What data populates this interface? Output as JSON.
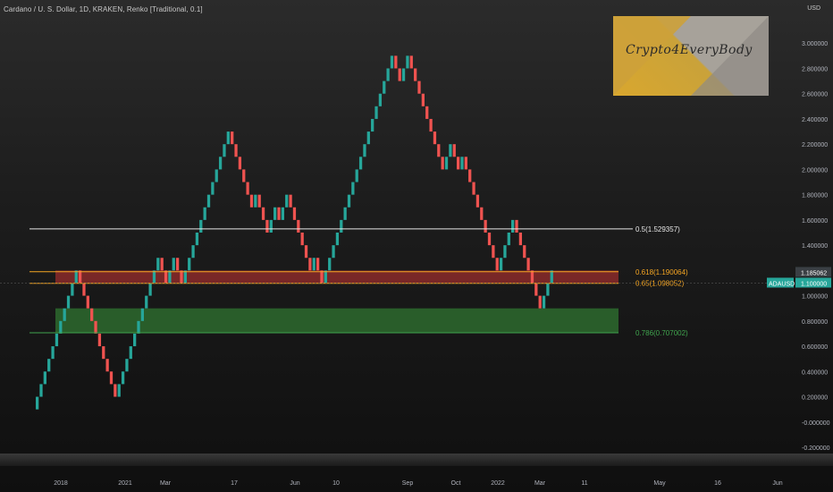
{
  "header": {
    "title": "Cardano / U. S. Dollar, 1D, KRAKEN, Renko [Traditional, 0.1]",
    "currency": "USD"
  },
  "logo": {
    "text": "Crypto4EveryBody"
  },
  "ticker": {
    "symbol": "ADAUSD",
    "last_price": "1.185062",
    "pending_price": "1.100000"
  },
  "colors": {
    "up": "#26a69a",
    "down": "#ef5350",
    "fib_white": "#e6e6e6",
    "fib_orange": "#f5a623",
    "fib_green": "#3fa34d",
    "resistance_zone": "#8b2a2a",
    "support_zone": "#2d6a2e",
    "ticker_badge": "#26a69a"
  },
  "chart_data": {
    "type": "renko",
    "brick_size": 0.1,
    "y_range": [
      -0.2,
      3.2
    ],
    "y_ticks": [
      "3.000000",
      "2.800000",
      "2.600000",
      "2.400000",
      "2.200000",
      "2.000000",
      "1.800000",
      "1.600000",
      "1.400000",
      "1.200000",
      "1.000000",
      "0.800000",
      "0.600000",
      "0.400000",
      "0.200000",
      "-0.000000",
      "-0.200000"
    ],
    "x_ticks": [
      "2018",
      "2021",
      "Mar",
      "17",
      "Jun",
      "10",
      "Sep",
      "Oct",
      "2022",
      "Mar",
      "11",
      "May",
      "16",
      "Jun"
    ],
    "bricks": [
      {
        "t": 0.2,
        "c": "up"
      },
      {
        "t": 0.3,
        "c": "up"
      },
      {
        "t": 0.4,
        "c": "up"
      },
      {
        "t": 0.5,
        "c": "up"
      },
      {
        "t": 0.6,
        "c": "up"
      },
      {
        "t": 0.7,
        "c": "up"
      },
      {
        "t": 0.8,
        "c": "up"
      },
      {
        "t": 0.9,
        "c": "up"
      },
      {
        "t": 1.0,
        "c": "up"
      },
      {
        "t": 1.1,
        "c": "up"
      },
      {
        "t": 1.2,
        "c": "up"
      },
      {
        "t": 1.1,
        "c": "down"
      },
      {
        "t": 1.0,
        "c": "down"
      },
      {
        "t": 0.9,
        "c": "down"
      },
      {
        "t": 0.8,
        "c": "down"
      },
      {
        "t": 0.7,
        "c": "down"
      },
      {
        "t": 0.6,
        "c": "down"
      },
      {
        "t": 0.5,
        "c": "down"
      },
      {
        "t": 0.4,
        "c": "down"
      },
      {
        "t": 0.3,
        "c": "down"
      },
      {
        "t": 0.2,
        "c": "down"
      },
      {
        "t": 0.3,
        "c": "up"
      },
      {
        "t": 0.4,
        "c": "up"
      },
      {
        "t": 0.5,
        "c": "up"
      },
      {
        "t": 0.6,
        "c": "up"
      },
      {
        "t": 0.7,
        "c": "up"
      },
      {
        "t": 0.8,
        "c": "up"
      },
      {
        "t": 0.9,
        "c": "up"
      },
      {
        "t": 1.0,
        "c": "up"
      },
      {
        "t": 1.1,
        "c": "up"
      },
      {
        "t": 1.2,
        "c": "up"
      },
      {
        "t": 1.3,
        "c": "up"
      },
      {
        "t": 1.2,
        "c": "down"
      },
      {
        "t": 1.1,
        "c": "down"
      },
      {
        "t": 1.2,
        "c": "up"
      },
      {
        "t": 1.3,
        "c": "up"
      },
      {
        "t": 1.2,
        "c": "down"
      },
      {
        "t": 1.1,
        "c": "down"
      },
      {
        "t": 1.2,
        "c": "up"
      },
      {
        "t": 1.3,
        "c": "up"
      },
      {
        "t": 1.4,
        "c": "up"
      },
      {
        "t": 1.5,
        "c": "up"
      },
      {
        "t": 1.6,
        "c": "up"
      },
      {
        "t": 1.7,
        "c": "up"
      },
      {
        "t": 1.8,
        "c": "up"
      },
      {
        "t": 1.9,
        "c": "up"
      },
      {
        "t": 2.0,
        "c": "up"
      },
      {
        "t": 2.1,
        "c": "up"
      },
      {
        "t": 2.2,
        "c": "up"
      },
      {
        "t": 2.3,
        "c": "up"
      },
      {
        "t": 2.2,
        "c": "down"
      },
      {
        "t": 2.1,
        "c": "down"
      },
      {
        "t": 2.0,
        "c": "down"
      },
      {
        "t": 1.9,
        "c": "down"
      },
      {
        "t": 1.8,
        "c": "down"
      },
      {
        "t": 1.7,
        "c": "down"
      },
      {
        "t": 1.8,
        "c": "up"
      },
      {
        "t": 1.7,
        "c": "down"
      },
      {
        "t": 1.6,
        "c": "down"
      },
      {
        "t": 1.5,
        "c": "down"
      },
      {
        "t": 1.6,
        "c": "up"
      },
      {
        "t": 1.7,
        "c": "up"
      },
      {
        "t": 1.6,
        "c": "down"
      },
      {
        "t": 1.7,
        "c": "up"
      },
      {
        "t": 1.8,
        "c": "up"
      },
      {
        "t": 1.7,
        "c": "down"
      },
      {
        "t": 1.6,
        "c": "down"
      },
      {
        "t": 1.5,
        "c": "down"
      },
      {
        "t": 1.4,
        "c": "down"
      },
      {
        "t": 1.3,
        "c": "down"
      },
      {
        "t": 1.2,
        "c": "down"
      },
      {
        "t": 1.3,
        "c": "up"
      },
      {
        "t": 1.2,
        "c": "down"
      },
      {
        "t": 1.1,
        "c": "down"
      },
      {
        "t": 1.2,
        "c": "up"
      },
      {
        "t": 1.3,
        "c": "up"
      },
      {
        "t": 1.4,
        "c": "up"
      },
      {
        "t": 1.5,
        "c": "up"
      },
      {
        "t": 1.6,
        "c": "up"
      },
      {
        "t": 1.7,
        "c": "up"
      },
      {
        "t": 1.8,
        "c": "up"
      },
      {
        "t": 1.9,
        "c": "up"
      },
      {
        "t": 2.0,
        "c": "up"
      },
      {
        "t": 2.1,
        "c": "up"
      },
      {
        "t": 2.2,
        "c": "up"
      },
      {
        "t": 2.3,
        "c": "up"
      },
      {
        "t": 2.4,
        "c": "up"
      },
      {
        "t": 2.5,
        "c": "up"
      },
      {
        "t": 2.6,
        "c": "up"
      },
      {
        "t": 2.7,
        "c": "up"
      },
      {
        "t": 2.8,
        "c": "up"
      },
      {
        "t": 2.9,
        "c": "up"
      },
      {
        "t": 2.8,
        "c": "down"
      },
      {
        "t": 2.7,
        "c": "down"
      },
      {
        "t": 2.8,
        "c": "up"
      },
      {
        "t": 2.9,
        "c": "up"
      },
      {
        "t": 2.8,
        "c": "down"
      },
      {
        "t": 2.7,
        "c": "down"
      },
      {
        "t": 2.6,
        "c": "down"
      },
      {
        "t": 2.5,
        "c": "down"
      },
      {
        "t": 2.4,
        "c": "down"
      },
      {
        "t": 2.3,
        "c": "down"
      },
      {
        "t": 2.2,
        "c": "down"
      },
      {
        "t": 2.1,
        "c": "down"
      },
      {
        "t": 2.0,
        "c": "down"
      },
      {
        "t": 2.1,
        "c": "up"
      },
      {
        "t": 2.2,
        "c": "up"
      },
      {
        "t": 2.1,
        "c": "down"
      },
      {
        "t": 2.0,
        "c": "down"
      },
      {
        "t": 2.1,
        "c": "up"
      },
      {
        "t": 2.0,
        "c": "down"
      },
      {
        "t": 1.9,
        "c": "down"
      },
      {
        "t": 1.8,
        "c": "down"
      },
      {
        "t": 1.7,
        "c": "down"
      },
      {
        "t": 1.6,
        "c": "down"
      },
      {
        "t": 1.5,
        "c": "down"
      },
      {
        "t": 1.4,
        "c": "down"
      },
      {
        "t": 1.3,
        "c": "down"
      },
      {
        "t": 1.2,
        "c": "down"
      },
      {
        "t": 1.3,
        "c": "up"
      },
      {
        "t": 1.4,
        "c": "up"
      },
      {
        "t": 1.5,
        "c": "up"
      },
      {
        "t": 1.6,
        "c": "up"
      },
      {
        "t": 1.5,
        "c": "down"
      },
      {
        "t": 1.4,
        "c": "down"
      },
      {
        "t": 1.3,
        "c": "down"
      },
      {
        "t": 1.2,
        "c": "down"
      },
      {
        "t": 1.1,
        "c": "down"
      },
      {
        "t": 1.0,
        "c": "down"
      },
      {
        "t": 0.9,
        "c": "down"
      },
      {
        "t": 1.0,
        "c": "up"
      },
      {
        "t": 1.1,
        "c": "up"
      },
      {
        "t": 1.2,
        "c": "up"
      }
    ],
    "levels": [
      {
        "label": "0.5(1.529357)",
        "value": 1.529357,
        "color": "fib_white"
      },
      {
        "label": "0.618(1.190064)",
        "value": 1.190064,
        "color": "fib_orange"
      },
      {
        "label": "0.65(1.098052)",
        "value": 1.098052,
        "color": "fib_orange"
      },
      {
        "label": "0.786(0.707002)",
        "value": 0.707002,
        "color": "fib_green"
      }
    ],
    "zones": [
      {
        "name": "resistance",
        "from": 1.1,
        "to": 1.2,
        "color": "resistance_zone"
      },
      {
        "name": "support",
        "from": 0.71,
        "to": 0.9,
        "color": "support_zone"
      }
    ]
  }
}
